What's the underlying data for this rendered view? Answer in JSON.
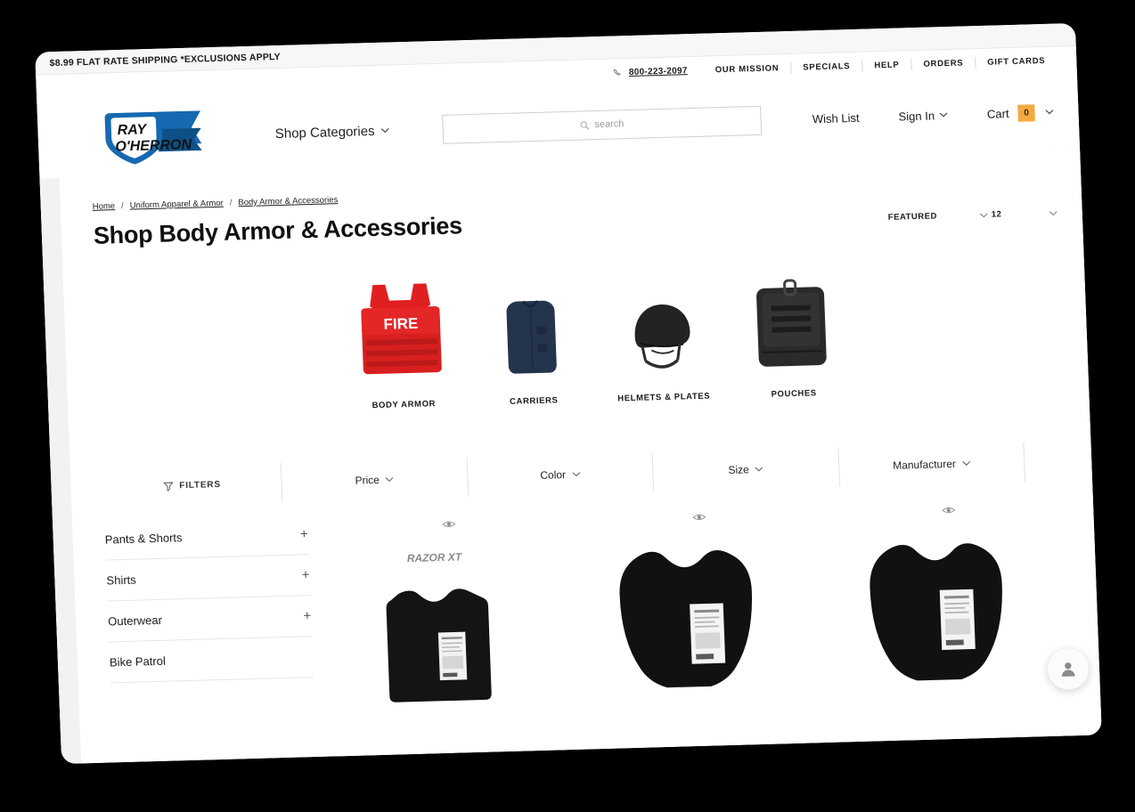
{
  "promo": {
    "text": "$8.99 FLAT RATE SHIPPING *EXCLUSIONS APPLY"
  },
  "utility_nav": {
    "phone_icon": "phone-icon",
    "phone": "800-223-2097",
    "items": [
      {
        "label": "OUR MISSION"
      },
      {
        "label": "SPECIALS"
      },
      {
        "label": "HELP"
      },
      {
        "label": "ORDERS"
      },
      {
        "label": "GIFT CARDS"
      }
    ]
  },
  "header": {
    "logo_alt": "RAY O'HERRON",
    "logo_line1": "RAY",
    "logo_line2": "O'HERRON",
    "shop_categories": "Shop Categories",
    "chevron_icon": "chevron-down-icon",
    "search": {
      "icon": "search-icon",
      "placeholder": "search",
      "value": ""
    },
    "wish_list": "Wish List",
    "sign_in": "Sign In",
    "cart_label": "Cart",
    "cart_count": "0",
    "cart_badge_color": "#f5a93f"
  },
  "breadcrumb": {
    "items": [
      {
        "label": "Home"
      },
      {
        "label": "Uniform Apparel & Armor"
      },
      {
        "label": "Body Armor & Accessories"
      }
    ],
    "separator": "/"
  },
  "page_title": "Shop Body Armor & Accessories",
  "sort": {
    "sort_by": "FEATURED",
    "per_page": "12",
    "chevron_icon": "chevron-down-icon"
  },
  "categories": [
    {
      "label": "BODY ARMOR",
      "icon": "body-armor-vest-red",
      "badge_text": "FIRE"
    },
    {
      "label": "CARRIERS",
      "icon": "carrier-vest-navy"
    },
    {
      "label": "HELMETS & PLATES",
      "icon": "ballistic-helmet-black"
    },
    {
      "label": "POUCHES",
      "icon": "tactical-pouch-black"
    }
  ],
  "filters": {
    "label": "FILTERS",
    "icon": "funnel-icon",
    "facets": [
      {
        "label": "Price"
      },
      {
        "label": "Color"
      },
      {
        "label": "Size"
      },
      {
        "label": "Manufacturer"
      }
    ],
    "chevron_icon": "chevron-down-icon"
  },
  "sidebar": {
    "items": [
      {
        "label": "Pants & Shorts",
        "expander": "+"
      },
      {
        "label": "Shirts",
        "expander": "+"
      },
      {
        "label": "Outerwear",
        "expander": "+"
      },
      {
        "label": "Bike Patrol",
        "expander": ""
      }
    ]
  },
  "products": [
    {
      "quickview_icon": "eye-icon",
      "brand": "RAZOR XT",
      "image_alt": "black ballistic vest panel with spec label"
    },
    {
      "quickview_icon": "eye-icon",
      "brand": "",
      "image_alt": "black ballistic vest panel with spec label"
    },
    {
      "quickview_icon": "eye-icon",
      "brand": "",
      "image_alt": "black ballistic vest panel with spec label"
    }
  ],
  "chat_widget": {
    "icon": "person-icon"
  }
}
